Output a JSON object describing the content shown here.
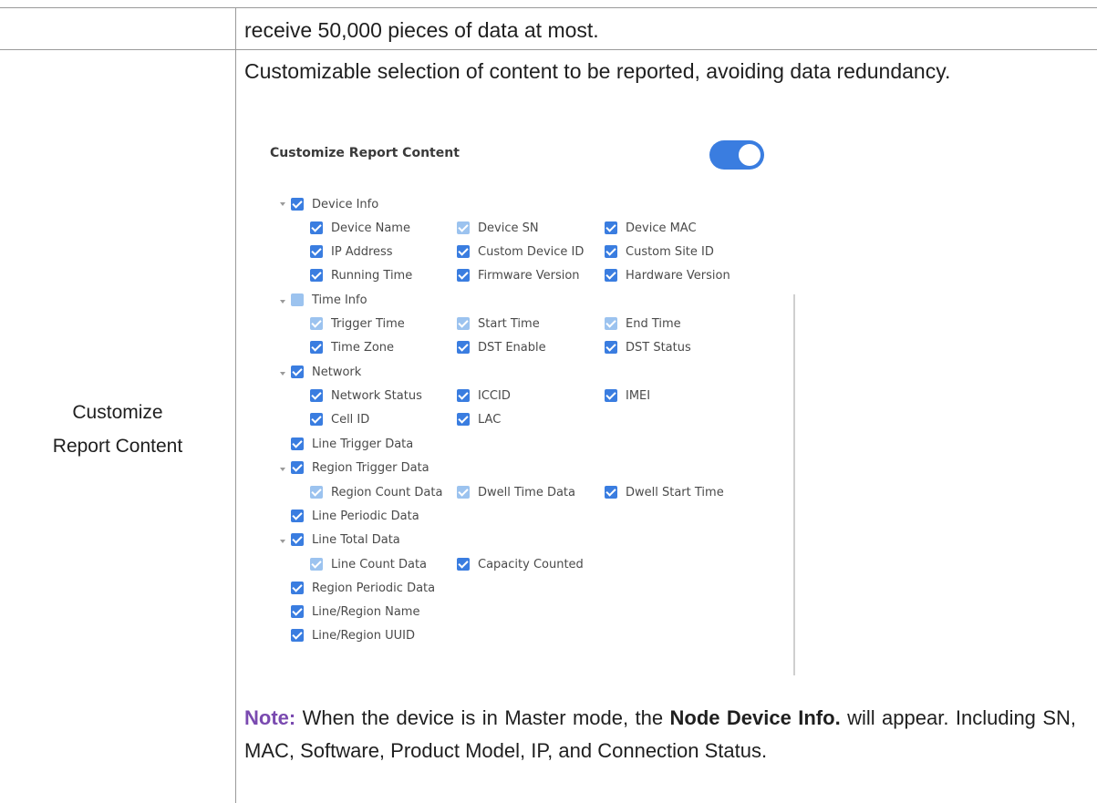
{
  "prev_row_text": "receive 50,000 pieces of data at most.",
  "row_label": [
    "Customize",
    "Report Content"
  ],
  "description": "Customizable selection of content to be reported, avoiding data redundancy.",
  "panel": {
    "title": "Customize Report Content",
    "toggle_on": true,
    "groups": {
      "device_info": "Device Info",
      "device_name": "Device Name",
      "device_sn": "Device SN",
      "device_mac": "Device MAC",
      "ip_address": "IP Address",
      "custom_device_id": "Custom Device ID",
      "custom_site_id": "Custom Site ID",
      "running_time": "Running Time",
      "firmware_version": "Firmware Version",
      "hardware_version": "Hardware Version",
      "time_info": "Time Info",
      "trigger_time": "Trigger Time",
      "start_time": "Start Time",
      "end_time": "End Time",
      "time_zone": "Time Zone",
      "dst_enable": "DST Enable",
      "dst_status": "DST Status",
      "network": "Network",
      "network_status": "Network Status",
      "iccid": "ICCID",
      "imei": "IMEI",
      "cell_id": "Cell ID",
      "lac": "LAC",
      "line_trigger_data": "Line Trigger Data",
      "region_trigger_data": "Region Trigger Data",
      "region_count_data": "Region Count Data",
      "dwell_time_data": "Dwell Time Data",
      "dwell_start_time": "Dwell Start Time",
      "line_periodic_data": "Line Periodic Data",
      "line_total_data": "Line Total Data",
      "line_count_data": "Line Count Data",
      "capacity_counted": "Capacity Counted",
      "region_periodic_data": "Region Periodic Data",
      "line_region_name": "Line/Region Name",
      "line_region_uuid": "Line/Region UUID"
    }
  },
  "note": {
    "label": "Note:",
    "text_1": " When the device is in Master mode, the ",
    "bold": "Node Device Info.",
    "text_2": " will appear. Including SN, MAC, Software, Product Model, IP, and Connection Status."
  },
  "colors": {
    "accent": "#3a7de0",
    "accent_light": "#9cc3ef",
    "note_label": "#7a4ab0"
  }
}
